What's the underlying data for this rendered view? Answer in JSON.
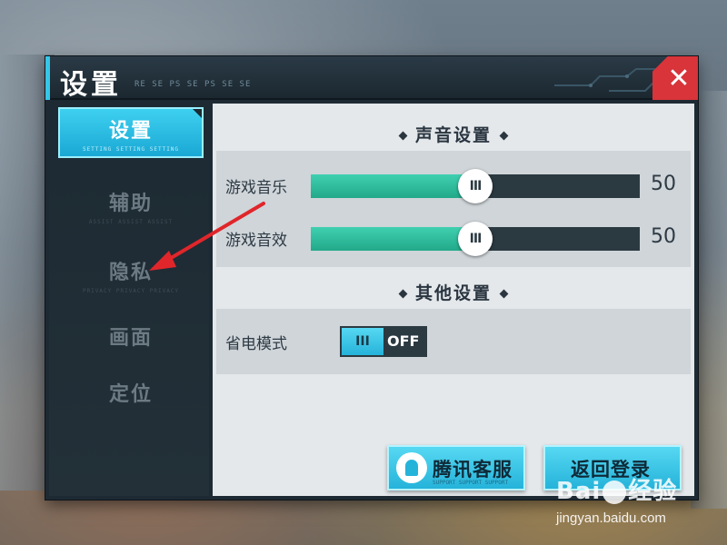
{
  "dialog": {
    "title": "设置",
    "subtitle": "RE SE PS SE PS SE SE"
  },
  "close_button": {
    "label": "✕"
  },
  "sidebar": {
    "items": [
      {
        "label": "设置",
        "sub": "SETTING SETTING SETTING",
        "active": true
      },
      {
        "label": "辅助",
        "sub": "ASSIST ASSIST ASSIST",
        "active": false
      },
      {
        "label": "隐私",
        "sub": "PRIVACY PRIVACY PRIVACY",
        "active": false
      },
      {
        "label": "画面",
        "sub": "",
        "active": false
      },
      {
        "label": "定位",
        "sub": "",
        "active": false
      }
    ]
  },
  "sound_settings": {
    "title": "声音设置",
    "music": {
      "label": "游戏音乐",
      "value": "50",
      "level": 0.5
    },
    "sfx": {
      "label": "游戏音效",
      "value": "50",
      "level": 0.5
    }
  },
  "other_settings": {
    "title": "其他设置",
    "power_saving": {
      "label": "省电模式",
      "state": "OFF",
      "thumb": "III"
    }
  },
  "buttons": {
    "support": {
      "label": "腾讯客服",
      "sub": "SUPPORT SUPPORT SUPPORT"
    },
    "back_login": {
      "label": "返回登录"
    }
  },
  "slider_grip": "III",
  "watermark": {
    "logo_left": "Bai",
    "logo_right": "经验",
    "url": "jingyan.baidu.com"
  },
  "colors": {
    "accent": "#25b3da",
    "slider_fill": "#22a98a",
    "close": "#d8343a",
    "annotation_arrow": "#e0262b"
  }
}
